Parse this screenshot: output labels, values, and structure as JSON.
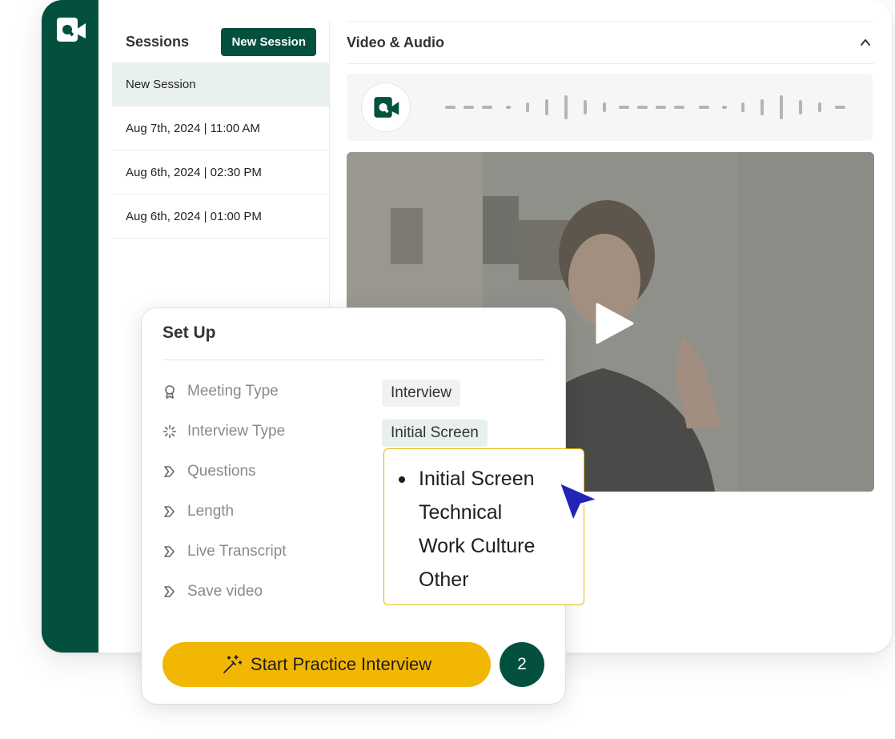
{
  "colors": {
    "brand": "#03503f",
    "accent": "#f2b702",
    "cursor": "#2323b8"
  },
  "sessions": {
    "title": "Sessions",
    "new_button": "New Session",
    "items": [
      {
        "label": "New Session",
        "active": true
      },
      {
        "label": "Aug 7th, 2024 | 11:00 AM"
      },
      {
        "label": "Aug 6th, 2024 | 02:30 PM"
      },
      {
        "label": "Aug 6th, 2024 | 01:00 PM"
      }
    ]
  },
  "media": {
    "title": "Video & Audio",
    "collapse_icon": "chevron-up-icon",
    "play_icon": "play-icon"
  },
  "setup": {
    "title": "Set Up",
    "rows": [
      {
        "label": "Meeting Type",
        "icon": "award-icon",
        "value": "Interview"
      },
      {
        "label": "Interview Type",
        "icon": "loader-icon",
        "value": "Initial Screen"
      },
      {
        "label": "Questions",
        "icon": "chevron-step-icon"
      },
      {
        "label": "Length",
        "icon": "chevron-step-icon"
      },
      {
        "label": "Live Transcript",
        "icon": "chevron-step-icon"
      },
      {
        "label": "Save video",
        "icon": "chevron-step-icon"
      }
    ],
    "dropdown_options": [
      "Initial Screen",
      "Technical",
      "Work Culture",
      "Other"
    ],
    "selected_option": "Initial Screen",
    "start_button": "Start Practice Interview",
    "step": "2"
  }
}
